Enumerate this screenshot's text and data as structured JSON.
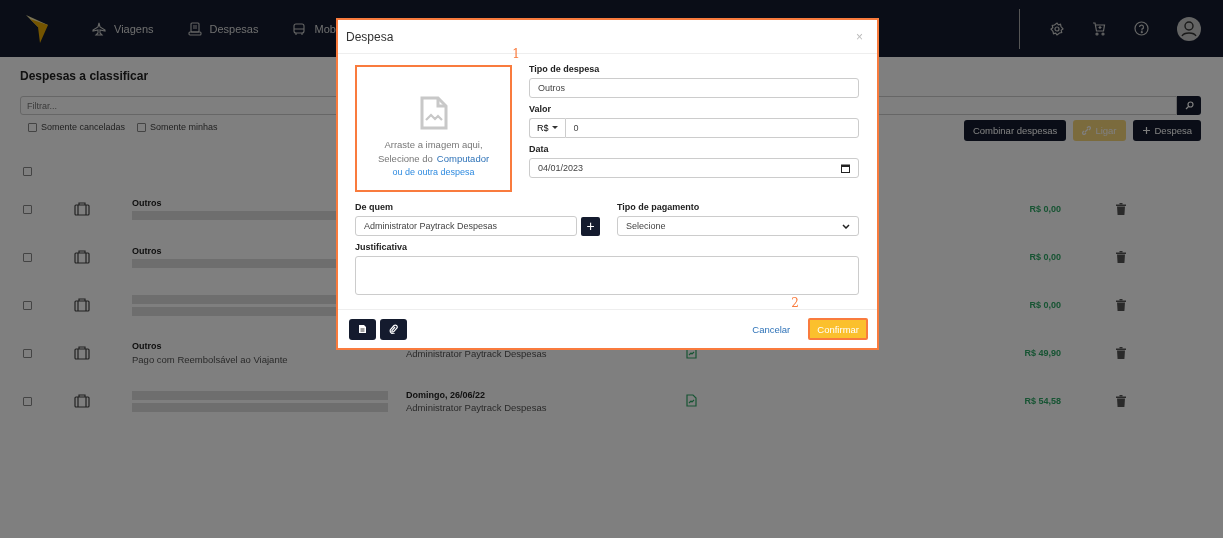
{
  "nav": {
    "items": [
      {
        "label": "Viagens"
      },
      {
        "label": "Despesas"
      },
      {
        "label": "Mob"
      }
    ]
  },
  "page": {
    "title": "Despesas a classificar",
    "filter_placeholder": "Filtrar...",
    "filters": [
      {
        "label": "Somente canceladas",
        "checked": false
      },
      {
        "label": "Somente minhas",
        "checked": false
      }
    ],
    "actions": [
      {
        "label": "Combinar despesas",
        "kind": "dark",
        "disabled": false
      },
      {
        "label": "Ligar",
        "kind": "link",
        "disabled": true
      },
      {
        "label": "Despesa",
        "kind": "add",
        "disabled": false
      }
    ]
  },
  "list": {
    "select_all_checked": false,
    "rows": [
      {
        "checked": false,
        "title": "Outros",
        "amount": "R$ 0,00"
      },
      {
        "checked": false,
        "title": "Outros",
        "amount": "R$ 0,00"
      },
      {
        "checked": false,
        "amount": "R$ 0,00"
      },
      {
        "checked": false,
        "title": "Outros",
        "subtitle": "Pago com Reembolsável ao Viajante",
        "detail": {
          "subtitle": "Administrator Paytrack Despesas"
        },
        "receipt": true,
        "amount": "R$ 49,90"
      },
      {
        "checked": false,
        "detail": {
          "title": "Domingo, 26/06/22",
          "subtitle": "Administrator Paytrack Despesas"
        },
        "receipt": true,
        "amount": "R$ 54,58"
      }
    ]
  },
  "modal": {
    "title": "Despesa",
    "close": "×",
    "upload": {
      "line1": "Arraste a imagem aqui,",
      "line2": "Selecione do",
      "link1": "Computador",
      "link2": "ou de outra despesa"
    },
    "expense_type": {
      "label": "Tipo de despesa",
      "value": "Outros"
    },
    "amount": {
      "label": "Valor",
      "currency": "R$",
      "value": "0"
    },
    "date": {
      "label": "Data",
      "value": "04/01/2023"
    },
    "from": {
      "label": "De quem",
      "value": "Administrator Paytrack Despesas",
      "add": "+"
    },
    "payment": {
      "label": "Tipo de pagamento",
      "value": "Selecione"
    },
    "justification": {
      "label": "Justificativa"
    },
    "cancel": "Cancelar",
    "confirm": "Confirmar"
  },
  "annotations": [
    "1",
    "2"
  ]
}
